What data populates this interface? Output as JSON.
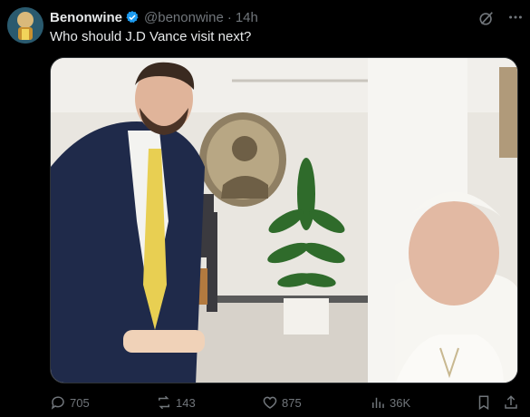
{
  "tweet": {
    "display_name": "Benonwine",
    "handle": "@benonwine",
    "separator": "·",
    "time": "14h",
    "text": "Who should J.D Vance visit next?"
  },
  "icons": {
    "verified": "verified-badge-icon",
    "grok": "grok-icon",
    "more": "more-icon",
    "reply": "reply-icon",
    "repost": "repost-icon",
    "like": "like-icon",
    "views": "views-icon",
    "bookmark": "bookmark-icon",
    "share": "share-icon"
  },
  "stats": {
    "replies": "705",
    "reposts": "143",
    "likes": "875",
    "views": "36K"
  },
  "colors": {
    "background": "#000000",
    "text": "#e7e9ea",
    "muted": "#71767b",
    "verified": "#1d9bf0"
  }
}
